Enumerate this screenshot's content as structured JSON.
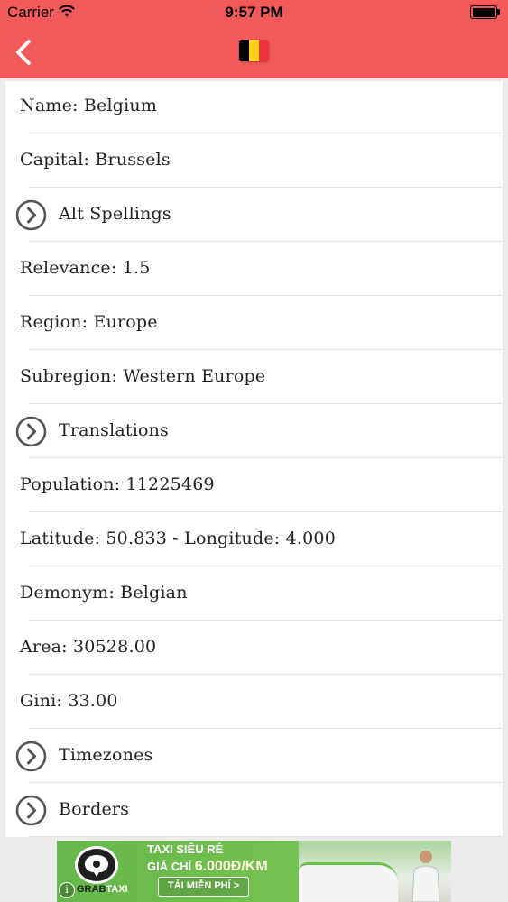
{
  "status_bar": {
    "carrier": "Carrier",
    "time": "9:57 PM"
  },
  "nav": {
    "back_icon": "chevron-left-icon",
    "flag_colors": [
      "#000000",
      "#fcd116",
      "#ef3340"
    ]
  },
  "rows": [
    {
      "label": "Name: Belgium",
      "expandable": false
    },
    {
      "label": "Capital: Brussels",
      "expandable": false
    },
    {
      "label": "Alt Spellings",
      "expandable": true
    },
    {
      "label": "Relevance: 1.5",
      "expandable": false
    },
    {
      "label": "Region: Europe",
      "expandable": false
    },
    {
      "label": "Subregion: Western Europe",
      "expandable": false
    },
    {
      "label": "Translations",
      "expandable": true
    },
    {
      "label": "Population: 11225469",
      "expandable": false
    },
    {
      "label": "Latitude: 50.833 - Longitude: 4.000",
      "expandable": false
    },
    {
      "label": "Demonym: Belgian",
      "expandable": false
    },
    {
      "label": "Area: 30528.00",
      "expandable": false
    },
    {
      "label": "Gini: 33.00",
      "expandable": false
    },
    {
      "label": "Timezones",
      "expandable": true
    },
    {
      "label": "Borders",
      "expandable": true
    }
  ],
  "ad": {
    "brand_prefix": "GRAB",
    "brand_suffix": "TAXI",
    "headline": "TAXI SIÊU RẺ",
    "price_prefix": "GIÁ CHỈ ",
    "price": "6.000Đ/KM",
    "cta": "TẢI MIỄN PHÍ >",
    "info_glyph": "i"
  },
  "colors": {
    "header": "#f25a5a",
    "background": "#ebebeb",
    "chevron": "#555555"
  }
}
